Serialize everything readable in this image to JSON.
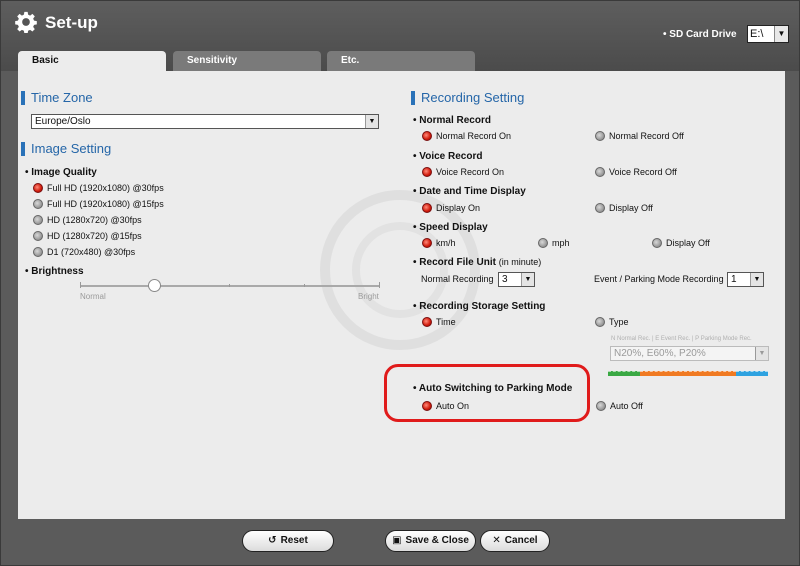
{
  "window": {
    "title": "Set-up"
  },
  "sd_card": {
    "label": "SD Card Drive",
    "value": "E:\\"
  },
  "tabs": [
    {
      "label": "Basic",
      "active": true
    },
    {
      "label": "Sensitivity",
      "active": false
    },
    {
      "label": "Etc.",
      "active": false
    }
  ],
  "time_zone": {
    "title": "Time Zone",
    "value": "Europe/Oslo"
  },
  "image_setting": {
    "title": "Image Setting",
    "quality_label": "Image Quality",
    "options": [
      {
        "label": "Full HD (1920x1080) @30fps",
        "selected": true
      },
      {
        "label": "Full HD (1920x1080) @15fps",
        "selected": false
      },
      {
        "label": "HD (1280x720) @30fps",
        "selected": false
      },
      {
        "label": "HD (1280x720) @15fps",
        "selected": false
      },
      {
        "label": "D1 (720x480) @30fps",
        "selected": false
      }
    ],
    "brightness_label": "Brightness",
    "brightness_min": "Normal",
    "brightness_max": "Bright",
    "brightness_level": 0.25
  },
  "recording": {
    "title": "Recording Setting",
    "normal_record": {
      "label": "Normal Record",
      "on": "Normal Record On",
      "off": "Normal Record Off"
    },
    "voice_record": {
      "label": "Voice Record",
      "on": "Voice Record On",
      "off": "Voice Record Off"
    },
    "date_time": {
      "label": "Date and Time Display",
      "on": "Display On",
      "off": "Display Off"
    },
    "speed": {
      "label": "Speed Display",
      "kmh": "km/h",
      "mph": "mph",
      "off": "Display Off"
    },
    "file_unit": {
      "label": "Record File Unit",
      "unit_note": "(in minute)",
      "normal_label": "Normal Recording",
      "normal_value": "3",
      "parking_label": "Event / Parking Mode Recording",
      "parking_value": "1"
    },
    "storage": {
      "label": "Recording Storage Setting",
      "time": "Time",
      "type": "Type",
      "legend": "N Normal Rec.  |  E Event Rec.  |  P Parking Mode Rec.",
      "ratio_value": "N20%, E60%, P20%"
    },
    "auto_switch": {
      "label": "Auto Switching to Parking Mode",
      "on": "Auto On",
      "off": "Auto Off"
    }
  },
  "buttons": {
    "reset": "Reset",
    "save_close": "Save & Close",
    "cancel": "Cancel"
  },
  "colors": {
    "accent": "#2566a8",
    "highlight": "#e01b1b",
    "radio_on": "#d01a0a"
  }
}
